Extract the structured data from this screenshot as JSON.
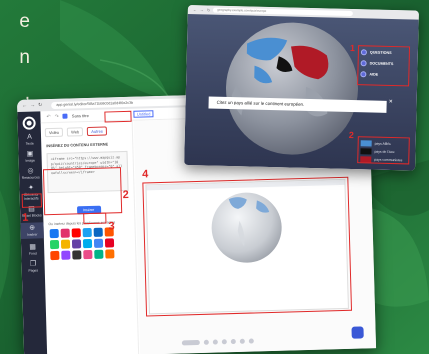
{
  "side_text": [
    "e",
    "n",
    ",",
    "z"
  ],
  "editor": {
    "url": "app.genial.ly/editor/5f8a71b58c0d1a0d4f6e2c3b",
    "doc_title": "Sans titre",
    "title_badge": "Untitled",
    "sidebar": [
      {
        "label": "Texte",
        "icon": "A"
      },
      {
        "label": "Image",
        "icon": "▣"
      },
      {
        "label": "Ressources",
        "icon": "◎"
      },
      {
        "label": "Éléments Interactifs",
        "icon": "✦"
      },
      {
        "label": "Smart Blocks",
        "icon": "▤"
      },
      {
        "label": "Insérer",
        "icon": "⊕"
      },
      {
        "label": "Fond",
        "icon": "▦"
      },
      {
        "label": "Pages",
        "icon": "❐"
      }
    ],
    "tabs": [
      "Vidéo",
      "Web",
      "Autres"
    ],
    "active_tab": "Autres",
    "insert_title": "INSÉREZ DU CONTENU EXTERNE",
    "code_text": "<iframe src=\"https://www.mapquiz.app/quiz/countries/europe\" width=\"100%\" height=\"450\" frameborder=\"0\" allowfullscreen></iframe>",
    "insert_button": "Insérer",
    "embed_label": "Ou insérez depuis les plateformes suivantes",
    "platform_colors": [
      "#1877f2",
      "#e1306c",
      "#ff0000",
      "#1da1f2",
      "#0a66c2",
      "#ff5500",
      "#25d366",
      "#f4b400",
      "#6441a5",
      "#00aced",
      "#4285f4",
      "#e60023",
      "#ff4500",
      "#9146ff",
      "#333333",
      "#ea4c89",
      "#00b488",
      "#ff6f00"
    ]
  },
  "quiz": {
    "url": "geography.example.com/quiz/europe",
    "menu": [
      "QUESTIONS",
      "DOCUMENTS",
      "AIDE"
    ],
    "prompt": "Citez un pays allié sur le continent européen.",
    "legend": [
      {
        "label": "pays Alliés",
        "color": "#4a8fd2"
      },
      {
        "label": "pays de l'Axe",
        "color": "#111111"
      },
      {
        "label": "pays communistes",
        "color": "#b01a26"
      }
    ]
  },
  "callouts": {
    "n1": "1",
    "n2": "2",
    "n3": "3",
    "n4": "4",
    "q1": "1",
    "q2": "2"
  }
}
